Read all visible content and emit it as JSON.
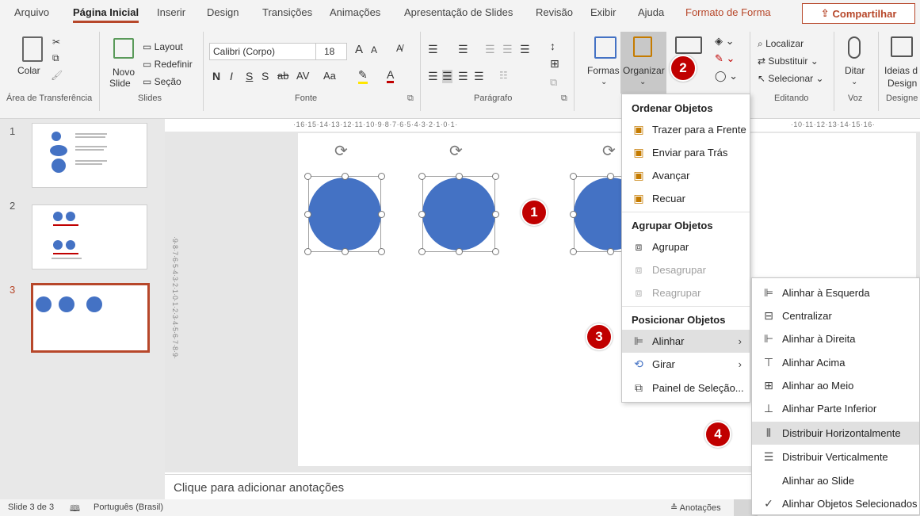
{
  "tabs": [
    "Arquivo",
    "Página Inicial",
    "Inserir",
    "Design",
    "Transições",
    "Animações",
    "Apresentação de Slides",
    "Revisão",
    "Exibir",
    "Ajuda",
    "Formato de Forma"
  ],
  "share_label": "Compartilhar",
  "ribbon": {
    "clipboard": {
      "paste": "Colar",
      "group": "Área de Transferência"
    },
    "slides": {
      "new_slide_1": "Novo",
      "new_slide_2": "Slide",
      "layout": "Layout",
      "reset": "Redefinir",
      "section": "Seção",
      "group": "Slides"
    },
    "font": {
      "name": "Calibri (Corpo)",
      "size": "18",
      "bold": "N",
      "italic": "I",
      "underline": "S",
      "strike": "S",
      "spacing": "AV",
      "case": "Aa",
      "grow": "A",
      "shrink": "A",
      "group": "Fonte"
    },
    "paragraph": {
      "group": "Parágrafo"
    },
    "drawing": {
      "shapes": "Formas",
      "arrange": "Organizar"
    },
    "editing": {
      "find": "Localizar",
      "replace": "Substituir",
      "select": "Selecionar",
      "group": "Editando"
    },
    "voice": {
      "dictate": "Ditar",
      "group": "Voz"
    },
    "designer": {
      "ideas_1": "Ideias d",
      "ideas_2": "Design",
      "group": "Designe"
    }
  },
  "ruler_text": "·16·15·14·13·12·11·10·9·8·7·6·5·4·3·2·1·0·1·",
  "ruler_text_right": "·10·11·12·13·14·15·16·",
  "vruler_text": "·9·8·7·6·5·4·3·2·1·0·1·2·3·4·5·6·7·8·9·",
  "thumbnails": [
    {
      "num": "1"
    },
    {
      "num": "2"
    },
    {
      "num": "3"
    }
  ],
  "notes_placeholder": "Clique para adicionar anotações",
  "status": {
    "slide": "Slide 3 de 3",
    "language": "Português (Brasil)",
    "notes": "Anotações"
  },
  "badges": [
    "1",
    "2",
    "3",
    "4"
  ],
  "arrange_menu": {
    "order_header": "Ordenar Objetos",
    "bring_front": "Trazer para a Frente",
    "send_back": "Enviar para Trás",
    "forward": "Avançar",
    "backward": "Recuar",
    "group_header": "Agrupar Objetos",
    "group": "Agrupar",
    "ungroup": "Desagrupar",
    "regroup": "Reagrupar",
    "position_header": "Posicionar Objetos",
    "align": "Alinhar",
    "rotate": "Girar",
    "selection_pane": "Painel de Seleção..."
  },
  "align_menu": {
    "left": "Alinhar à Esquerda",
    "center": "Centralizar",
    "right": "Alinhar à Direita",
    "top": "Alinhar Acima",
    "middle": "Alinhar ao Meio",
    "bottom": "Alinhar Parte Inferior",
    "dist_h": "Distribuir Horizontalmente",
    "dist_v": "Distribuir Verticalmente",
    "to_slide": "Alinhar ao Slide",
    "selected": "Alinhar Objetos Selecionados"
  },
  "colors": {
    "accent": "#b7472a",
    "shape": "#4472c4",
    "badge": "#c00000"
  }
}
